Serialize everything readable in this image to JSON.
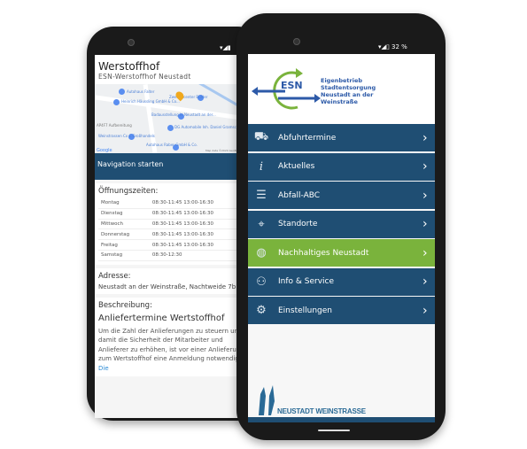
{
  "left_phone": {
    "title": "Werstoffhof",
    "subtitle": "ESN-Werstoffhof Neustadt",
    "map_labels": [
      "Autohaus Falter",
      "Heinrich Häussling GmbH & Co...",
      "Zweiradcenter Bühler",
      "Badausstellung in Neustadt an der...",
      "AP4F7 Aufbereitung",
      "DG Automobile Inh. Daniel Gramsch",
      "Weinstrassen Cx C Großhandels",
      "Autohaus Raber GmbH & Co."
    ],
    "map_attribution": "Map data ©2020 GeoBasis",
    "google": "Google",
    "nav_button": "Navigation starten",
    "hours_heading": "Öffnungszeiten:",
    "hours": [
      {
        "day": "Montag",
        "time": "08:30-11:45 13:00-16:30"
      },
      {
        "day": "Dienstag",
        "time": "08:30-11:45 13:00-16:30"
      },
      {
        "day": "Mittwoch",
        "time": "08:30-11:45 13:00-16:30"
      },
      {
        "day": "Donnerstag",
        "time": "08:30-11:45 13:00-16:30"
      },
      {
        "day": "Freitag",
        "time": "08:30-11:45 13:00-16:30"
      },
      {
        "day": "Samstag",
        "time": "08:30-12:30"
      }
    ],
    "address_heading": "Adresse:",
    "address": "Neustadt an der Weinstraße, Nachtweide 7b",
    "desc_heading": "Beschreibung:",
    "desc_title": "Anliefertermine Wertstoffhof",
    "desc_text": "Um die Zahl der Anlieferungen zu steuern und damit die Sicherheit der Mitarbeiter und Anlieferer zu erhöhen, ist vor einer Anlieferung zum Wertstoffhof eine Anmeldung notwendig.",
    "desc_link": "Die"
  },
  "right_phone": {
    "status": {
      "battery": "32 %"
    },
    "logo": {
      "abbr": "ESN",
      "name_lines": [
        "Eigenbetrieb",
        "Stadtentsorgung",
        "Neustadt an der",
        "Weinstraße"
      ]
    },
    "menu": [
      {
        "label": "Abfuhrtermine",
        "icon": "truck-icon"
      },
      {
        "label": "Aktuelles",
        "icon": "info-icon"
      },
      {
        "label": "Abfall-ABC",
        "icon": "list-icon"
      },
      {
        "label": "Standorte",
        "icon": "location-pin-icon"
      },
      {
        "label": "Nachhaltiges Neustadt",
        "icon": "globe-icon",
        "highlighted": true
      },
      {
        "label": "Info & Service",
        "icon": "person-icon"
      },
      {
        "label": "Einstellungen",
        "icon": "gear-icon"
      }
    ],
    "footer_logo": "NEUSTADT WEINSTRASSE"
  },
  "colors": {
    "menu_blue": "#1f4e73",
    "highlight_green": "#7ab33c",
    "logo_blue": "#2d5aa8"
  }
}
